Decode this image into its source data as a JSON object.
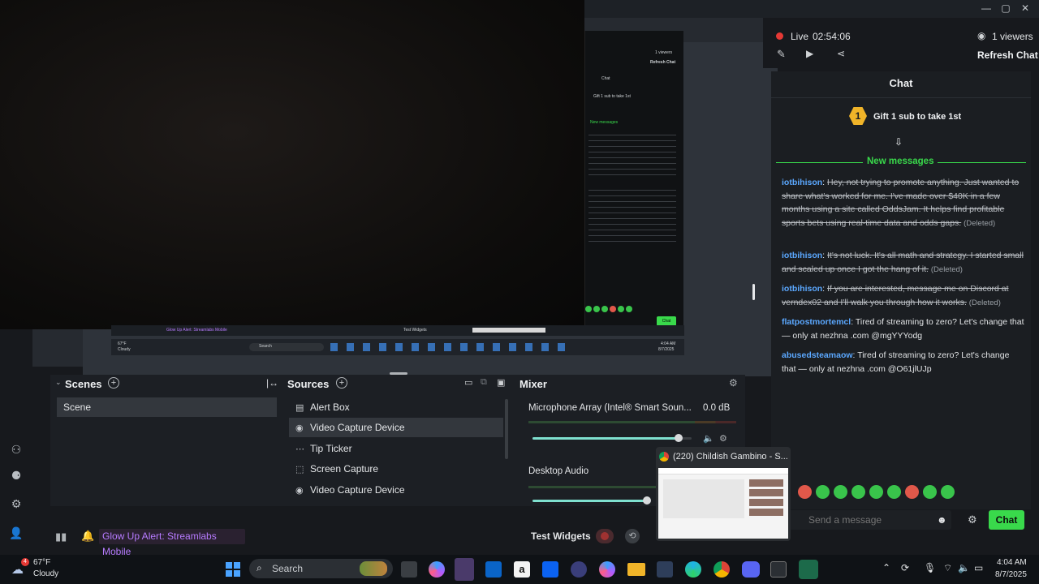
{
  "window": {
    "min": "—",
    "max": "▢",
    "close": "✕"
  },
  "preview": {
    "mini_viewers": "1 viewers",
    "mini_refresh": "Refresh Chat",
    "mini_chat": "Chat",
    "mini_gift": "Gift 1 sub to take 1st",
    "mini_new": "New messages",
    "mini_bottom_alert": "Glow Up Alert: Streamlabs Mobile",
    "mini_test": "Test Widgets",
    "mini_chat_btn": "Chat",
    "mini_temp": "67°F",
    "mini_weather": "Cloudy",
    "mini_search": "Search",
    "mini_time": "4:04 AM",
    "mini_date": "8/7/2025"
  },
  "scenes": {
    "title": "Scenes",
    "items": [
      "Scene"
    ]
  },
  "sources": {
    "title": "Sources",
    "items": [
      "Alert Box",
      "Video Capture Device",
      "Tip Ticker",
      "Screen Capture",
      "Video Capture Device"
    ]
  },
  "mixer": {
    "title": "Mixer",
    "channels": [
      {
        "name": "Microphone Array (Intel® Smart Soun...",
        "db": "0.0 dB",
        "level": 0.92
      },
      {
        "name": "Desktop Audio",
        "db": "",
        "level": 0.98
      }
    ]
  },
  "statusbar": {
    "alert": "Glow Up Alert: Streamlabs Mobile",
    "test_widgets": "Test Widgets"
  },
  "chat": {
    "live": "Live",
    "timer": "02:54:06",
    "viewers": "1 viewers",
    "refresh": "Refresh Chat",
    "title": "Chat",
    "gift_rank": "1",
    "gift_text": "Gift 1 sub to take 1st",
    "new_messages": "New messages",
    "messages": [
      {
        "user": "iotbihison",
        "text": "Hey, not trying to promote anything. Just wanted to share what's worked for me. I've made over $40K in a few months using a site called OddsJam. It helps find profitable sports bets using real-time data and odds gaps.",
        "deleted": true,
        "deleted_label": "(Deleted)"
      },
      {
        "user": "iotbihison",
        "text": "It's not luck. It's all math and strategy. I started small and scaled up once I got the hang of it.",
        "deleted": true,
        "deleted_label": "(Deleted)"
      },
      {
        "user": "iotbihison",
        "text": "If you are interested, message me on Discord at verndex02 and I'll walk you through how it works.",
        "deleted": true,
        "deleted_label": "(Deleted)"
      },
      {
        "user": "flatpostmortemcl",
        "text": "Tired of streaming to zero? Let's change that — only at nezhna .com @mgYYYodg",
        "deleted": false,
        "deleted_label": ""
      },
      {
        "user": "abusedsteamaow",
        "text": "Tired of streaming to zero? Let's change that — only at nezhna .com @O61jlUJp",
        "deleted": false,
        "deleted_label": ""
      }
    ],
    "input_placeholder": "Send a message",
    "send_label": "Chat"
  },
  "thumbnail": {
    "title": "(220) Childish Gambino - S..."
  },
  "taskbar": {
    "temp": "67°F",
    "weather": "Cloudy",
    "weather_badge": "4",
    "search_placeholder": "Search",
    "time": "4:04 AM",
    "date": "8/7/2025"
  },
  "colors": {
    "accent_green": "#39d94b",
    "username_blue": "#5ba8ff",
    "live_red": "#e53935",
    "gold": "#f0b429"
  }
}
